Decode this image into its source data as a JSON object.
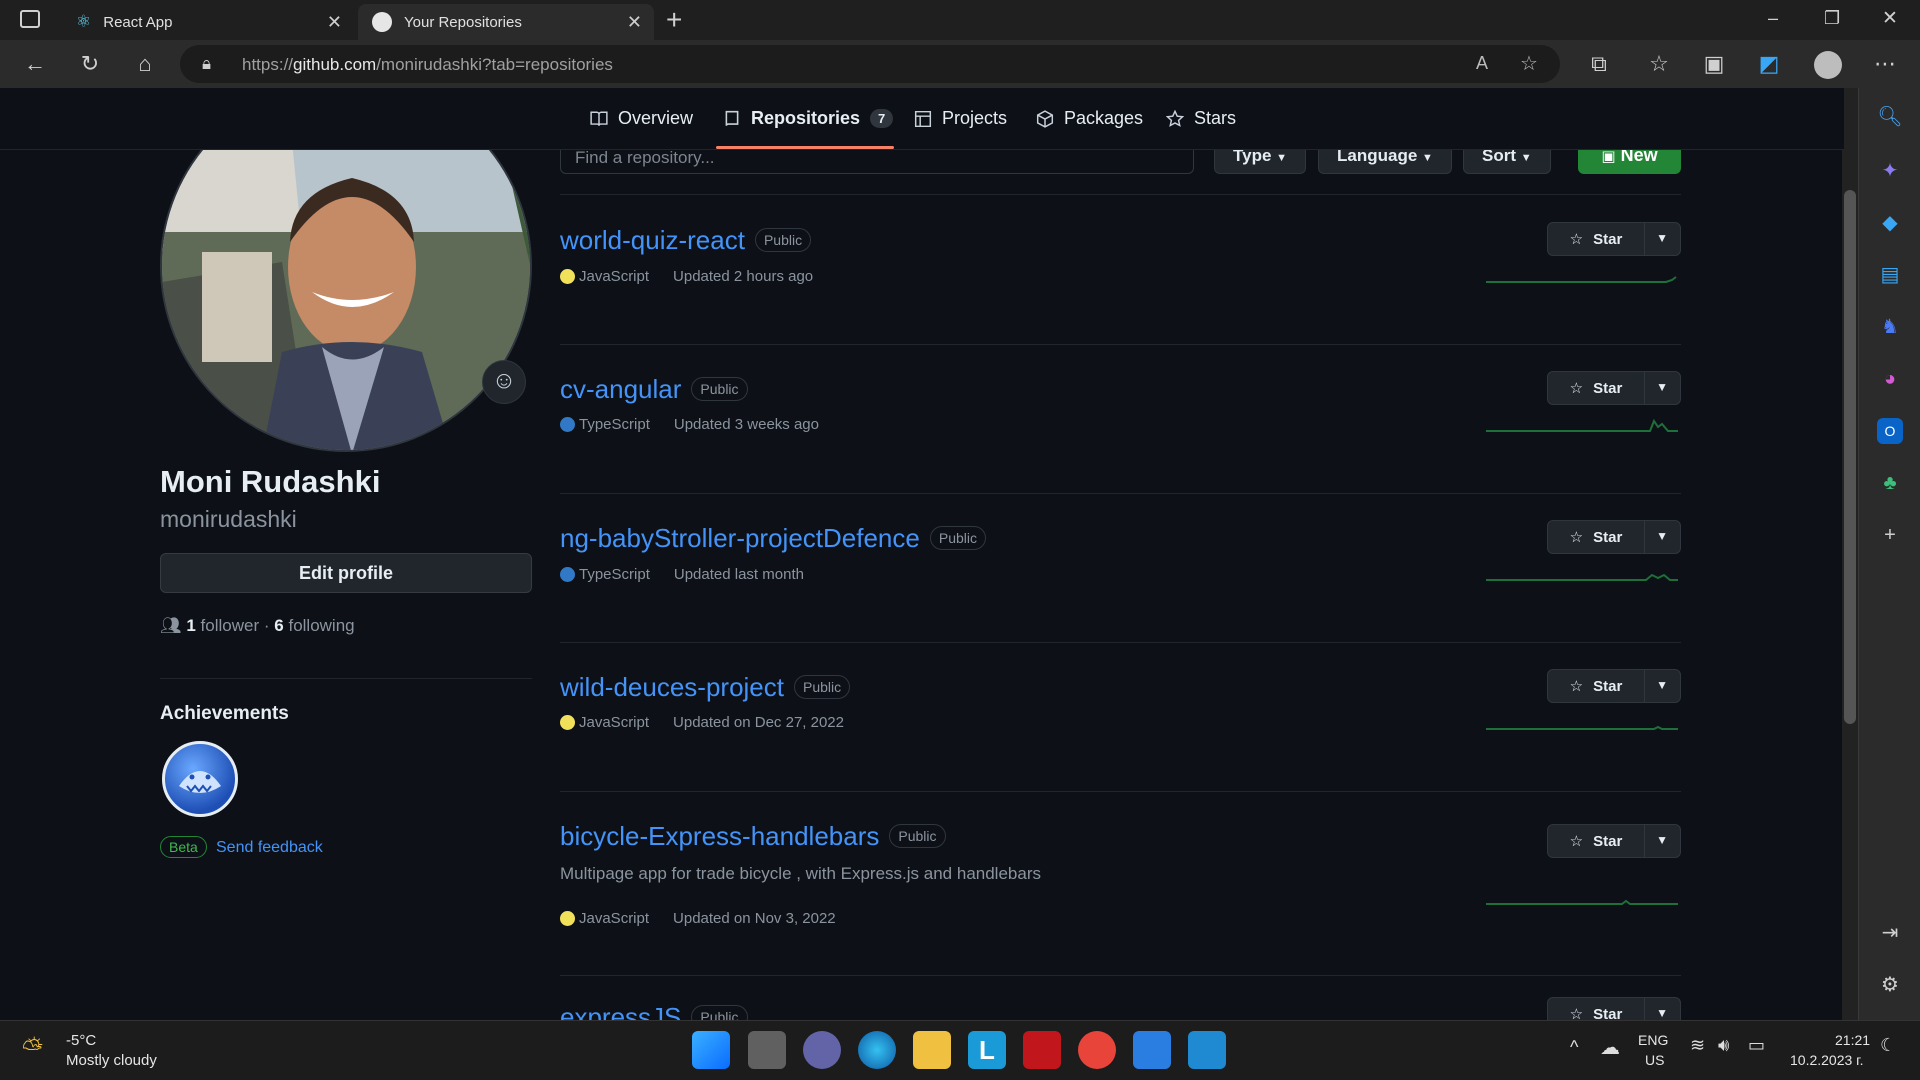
{
  "browser": {
    "tabs": [
      {
        "title": "React App",
        "active": false
      },
      {
        "title": "Your Repositories",
        "active": true
      }
    ],
    "new_tab": "+",
    "url_prefix": "https://",
    "url_host": "github.com",
    "url_path": "/monirudashki?tab=repositories",
    "window_controls": {
      "minimize": "–",
      "restore": "❐",
      "close": "✕"
    }
  },
  "nav": {
    "items": [
      {
        "label": "Overview",
        "icon": "book-icon"
      },
      {
        "label": "Repositories",
        "icon": "repo-icon",
        "count": "7",
        "selected": true
      },
      {
        "label": "Projects",
        "icon": "table-icon"
      },
      {
        "label": "Packages",
        "icon": "package-icon"
      },
      {
        "label": "Stars",
        "icon": "star-icon"
      }
    ]
  },
  "profile": {
    "name": "Moni Rudashki",
    "login": "monirudashki",
    "edit_label": "Edit profile",
    "followers": "1",
    "followers_label": "follower",
    "following": "6",
    "following_label": "following",
    "follow_sep": "·",
    "achievements_title": "Achievements",
    "beta_label": "Beta",
    "feedback_label": "Send feedback"
  },
  "filters": {
    "search_placeholder": "Find a repository...",
    "type_label": "Type",
    "language_label": "Language",
    "sort_label": "Sort",
    "new_label": "New"
  },
  "repos": [
    {
      "name": "world-quiz-react",
      "visibility": "Public",
      "description": "",
      "language": "JavaScript",
      "lang_color": "#f1e05a",
      "updated": "Updated 2 hours ago",
      "star_label": "Star"
    },
    {
      "name": "cv-angular",
      "visibility": "Public",
      "description": "",
      "language": "TypeScript",
      "lang_color": "#3178c6",
      "updated": "Updated 3 weeks ago",
      "star_label": "Star"
    },
    {
      "name": "ng-babyStroller-projectDefence",
      "visibility": "Public",
      "description": "",
      "language": "TypeScript",
      "lang_color": "#3178c6",
      "updated": "Updated last month",
      "star_label": "Star"
    },
    {
      "name": "wild-deuces-project",
      "visibility": "Public",
      "description": "",
      "language": "JavaScript",
      "lang_color": "#f1e05a",
      "updated": "Updated on Dec 27, 2022",
      "star_label": "Star"
    },
    {
      "name": "bicycle-Express-handlebars",
      "visibility": "Public",
      "description": "Multipage app for trade bicycle , with Express.js and handlebars",
      "language": "JavaScript",
      "lang_color": "#f1e05a",
      "updated": "Updated on Nov 3, 2022",
      "star_label": "Star"
    },
    {
      "name": "expressJS",
      "visibility": "Public",
      "description": "",
      "language": "",
      "lang_color": "",
      "updated": "",
      "star_label": "Star"
    }
  ],
  "taskbar": {
    "weather_temp": "-5°C",
    "weather_desc": "Mostly cloudy",
    "lang_top": "ENG",
    "lang_bottom": "US",
    "time": "21:21",
    "date": "10.2.2023 г."
  },
  "colors": {
    "accent_green": "#238636",
    "link_blue": "#4493f8",
    "underline": "#f78166"
  }
}
